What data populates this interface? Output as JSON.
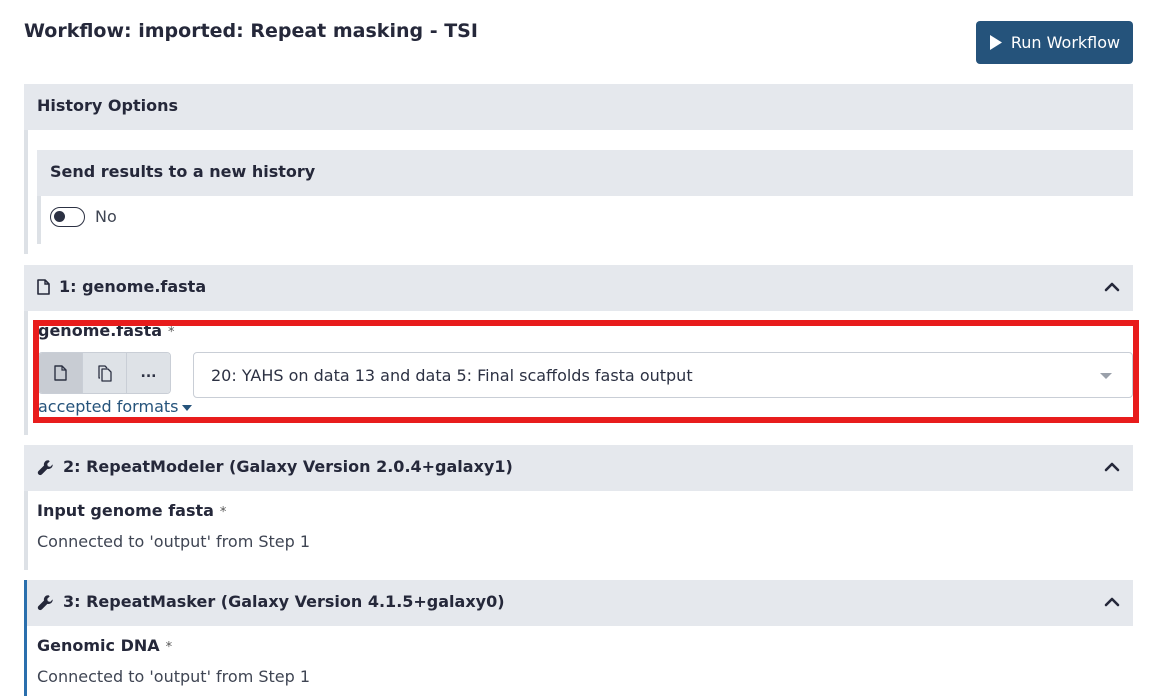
{
  "header": {
    "title": "Workflow: imported: Repeat masking - TSI",
    "run_label": "Run Workflow"
  },
  "history_options": {
    "title": "History Options",
    "send_results_title": "Send results to a new history",
    "toggle_value": "No"
  },
  "step1": {
    "title": "1: genome.fasta",
    "field_label": "genome.fasta",
    "required_mark": "*",
    "selected_value": "20: YAHS on data 13 and data 5: Final scaffolds fasta output",
    "more_label": "...",
    "accepted_formats": "accepted formats"
  },
  "step2": {
    "title": "2: RepeatModeler (Galaxy Version 2.0.4+galaxy1)",
    "input_label": "Input genome fasta",
    "required_mark": "*",
    "connection": "Connected to 'output' from Step 1"
  },
  "step3": {
    "title": "3: RepeatMasker (Galaxy Version 4.1.5+galaxy0)",
    "input_label": "Genomic DNA",
    "required_mark": "*",
    "connection": "Connected to 'output' from Step 1"
  },
  "colors": {
    "accent": "#25537b",
    "highlight": "#e81c1c",
    "panel": "#e5e8ed",
    "active_left_border": "#2a6fad"
  },
  "icons": [
    "play-icon",
    "file-icon",
    "files-copy-icon",
    "ellipsis-icon",
    "chevron-up-icon",
    "wrench-icon",
    "caret-down-icon"
  ]
}
